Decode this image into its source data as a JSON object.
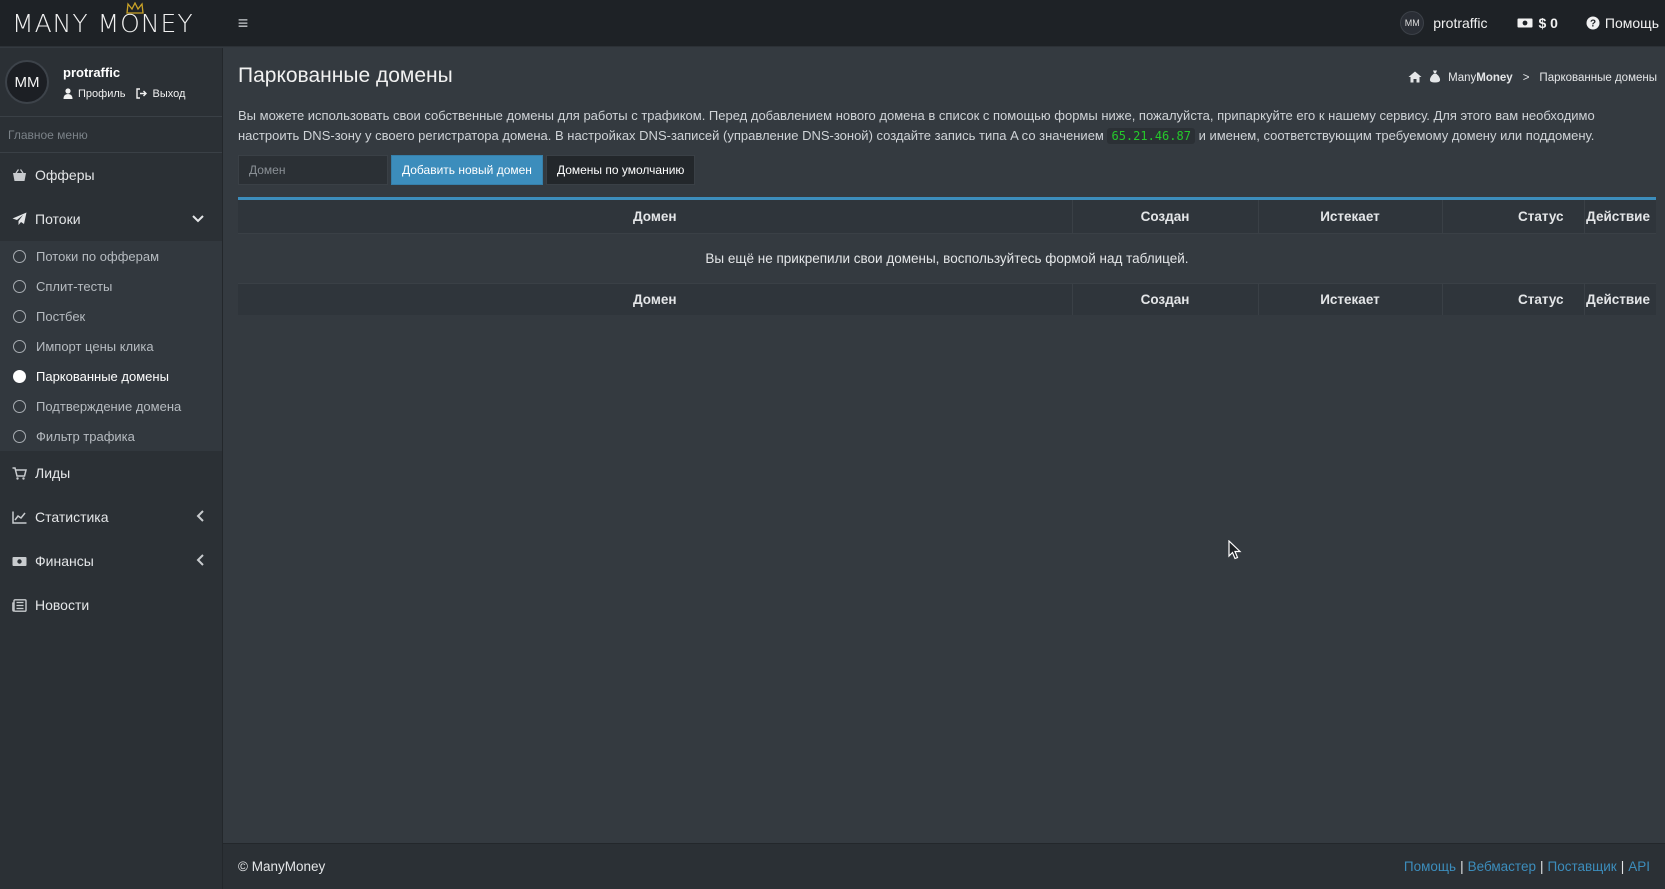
{
  "brand": {
    "name": "MANY MONEY"
  },
  "navbar": {
    "menu_toggle": "≡",
    "user": {
      "avatar_text": "MM",
      "name": "protraffic"
    },
    "balance": "$ 0",
    "help": "Помощь"
  },
  "sidebar": {
    "user_panel": {
      "avatar_text": "MM",
      "name": "protraffic",
      "profile": "Профиль",
      "logout": "Выход"
    },
    "menu_header": "Главное меню",
    "items": [
      {
        "label": "Офферы",
        "icon": "basket-icon"
      },
      {
        "label": "Потоки",
        "icon": "paper-plane-icon",
        "expanded": true
      },
      {
        "label": "Лиды",
        "icon": "cart-icon"
      },
      {
        "label": "Статистика",
        "icon": "chart-icon"
      },
      {
        "label": "Финансы",
        "icon": "money-icon"
      },
      {
        "label": "Новости",
        "icon": "newspaper-icon"
      }
    ],
    "subitems": [
      {
        "label": "Потоки по офферам"
      },
      {
        "label": "Сплит-тесты"
      },
      {
        "label": "Постбек"
      },
      {
        "label": "Импорт цены клика"
      },
      {
        "label": "Паркованные домены",
        "active": true
      },
      {
        "label": "Подтверждение домена"
      },
      {
        "label": "Фильтр трафика"
      }
    ]
  },
  "main": {
    "title": "Паркованные домены",
    "breadcrumb": {
      "home_prefix": "Many",
      "home_bold": "Money",
      "separator": ">",
      "current": "Паркованные домены"
    },
    "intro_part1": "Вы можете использовать свои собственные домены для работы с трафиком. Перед добавлением нового домена в список с помощью формы ниже, пожалуйста, припаркуйте его к нашему сервису. Для этого вам необходимо настроить DNS-зону у своего регистратора домена. В настройках DNS-записей (управление DNS-зоной) создайте запись типа A со значением",
    "ip": "65.21.46.87",
    "intro_part2": "и именем, соответствующим требуемому домену или поддомену.",
    "form": {
      "domain_placeholder": "Домен",
      "add_button": "Добавить новый домен",
      "default_button": "Домены по умолчанию"
    },
    "table": {
      "headers": [
        "Домен",
        "Создан",
        "Истекает",
        "Статус",
        "Действие"
      ],
      "empty_message": "Вы ещё не прикрепили свои домены, воспользуйтесь формой над таблицей."
    }
  },
  "footer": {
    "copyright": "© ManyMoney",
    "links": [
      "Помощь",
      "Вебмастер",
      "Поставщик",
      "API"
    ],
    "separator": "|"
  },
  "colors": {
    "accent": "#3c8dbc",
    "ip": "#25c82b",
    "sidebar": "#2b3035",
    "content": "#343a40",
    "navbar": "#1e2226"
  }
}
